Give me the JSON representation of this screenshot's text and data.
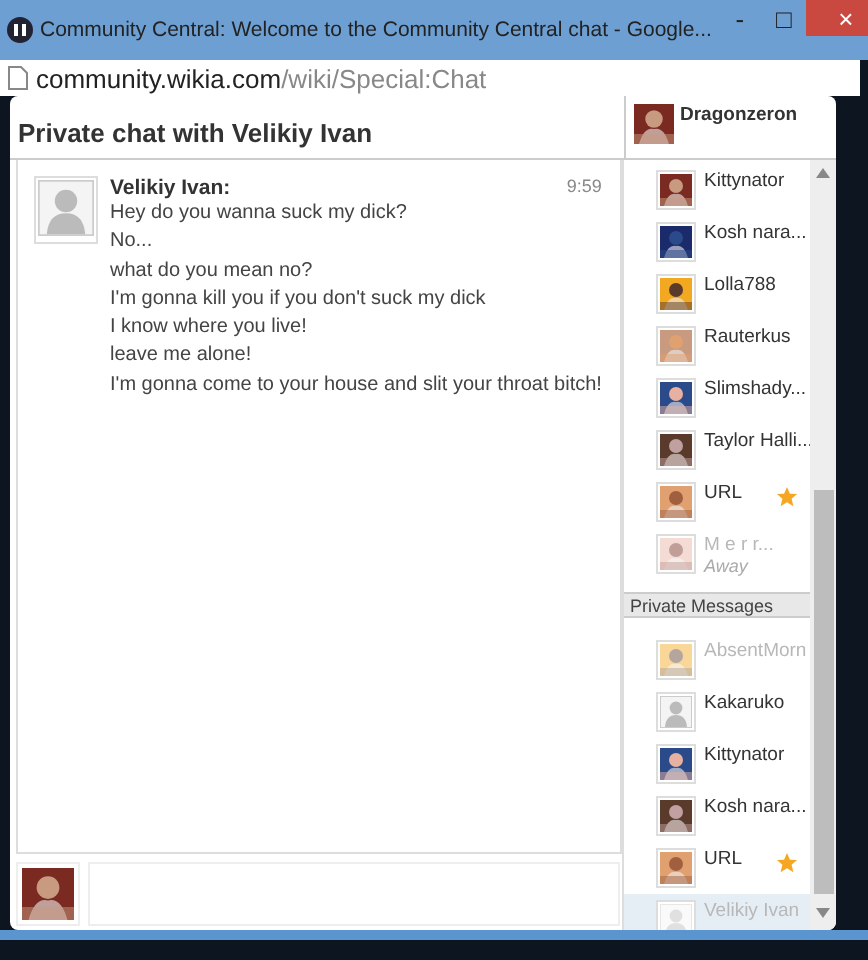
{
  "window": {
    "title": "Community Central: Welcome to the Community Central chat - Google...",
    "url_host": "community.wikia.com",
    "url_path": "/wiki/Special:Chat",
    "controls": [
      "-",
      "□",
      "×"
    ]
  },
  "chat": {
    "title": "Private chat with Velikiy Ivan",
    "current_user": {
      "name": "Dragonzeron"
    },
    "messages": [
      {
        "author": "Velikiy Ivan:",
        "time": "9:59",
        "avatar": {
          "kind": "default"
        },
        "lines": [
          "Hey do you wanna suck my dick?",
          "No...",
          "what do you mean no?",
          "I'm gonna kill you if you don't suck my dick",
          "I know where you live!",
          "leave me alone!",
          "I'm gonna come to your house and slit your throat bitch!"
        ]
      }
    ]
  },
  "users": [
    {
      "name": "Kittynator",
      "starred": false,
      "away": false
    },
    {
      "name": "Kosh nara...",
      "starred": false,
      "away": false
    },
    {
      "name": "Lolla788",
      "starred": false,
      "away": false
    },
    {
      "name": "Rauterkus",
      "starred": false,
      "away": false
    },
    {
      "name": "Slimshady...",
      "starred": false,
      "away": false
    },
    {
      "name": "Taylor Halli...",
      "starred": false,
      "away": false
    },
    {
      "name": "URL",
      "starred": true,
      "away": false
    },
    {
      "name": "M e r r...",
      "starred": false,
      "away": true,
      "status": "Away"
    }
  ],
  "private_messages": {
    "title": "Private Messages",
    "items": [
      {
        "name": "AbsentMorn",
        "starred": false,
        "away": true,
        "selected": false
      },
      {
        "name": "Kakaruko",
        "avatar": {
          "kind": "default"
        },
        "starred": false,
        "away": false,
        "selected": false
      },
      {
        "name": "Kittynator",
        "starred": false,
        "away": false,
        "selected": false
      },
      {
        "name": "Kosh nara...",
        "starred": false,
        "away": false,
        "selected": false
      },
      {
        "name": "URL",
        "starred": true,
        "away": false,
        "selected": false
      },
      {
        "name": "Velikiy Ivan",
        "avatar": {
          "kind": "default"
        },
        "starred": false,
        "away": true,
        "selected": true
      }
    ]
  }
}
